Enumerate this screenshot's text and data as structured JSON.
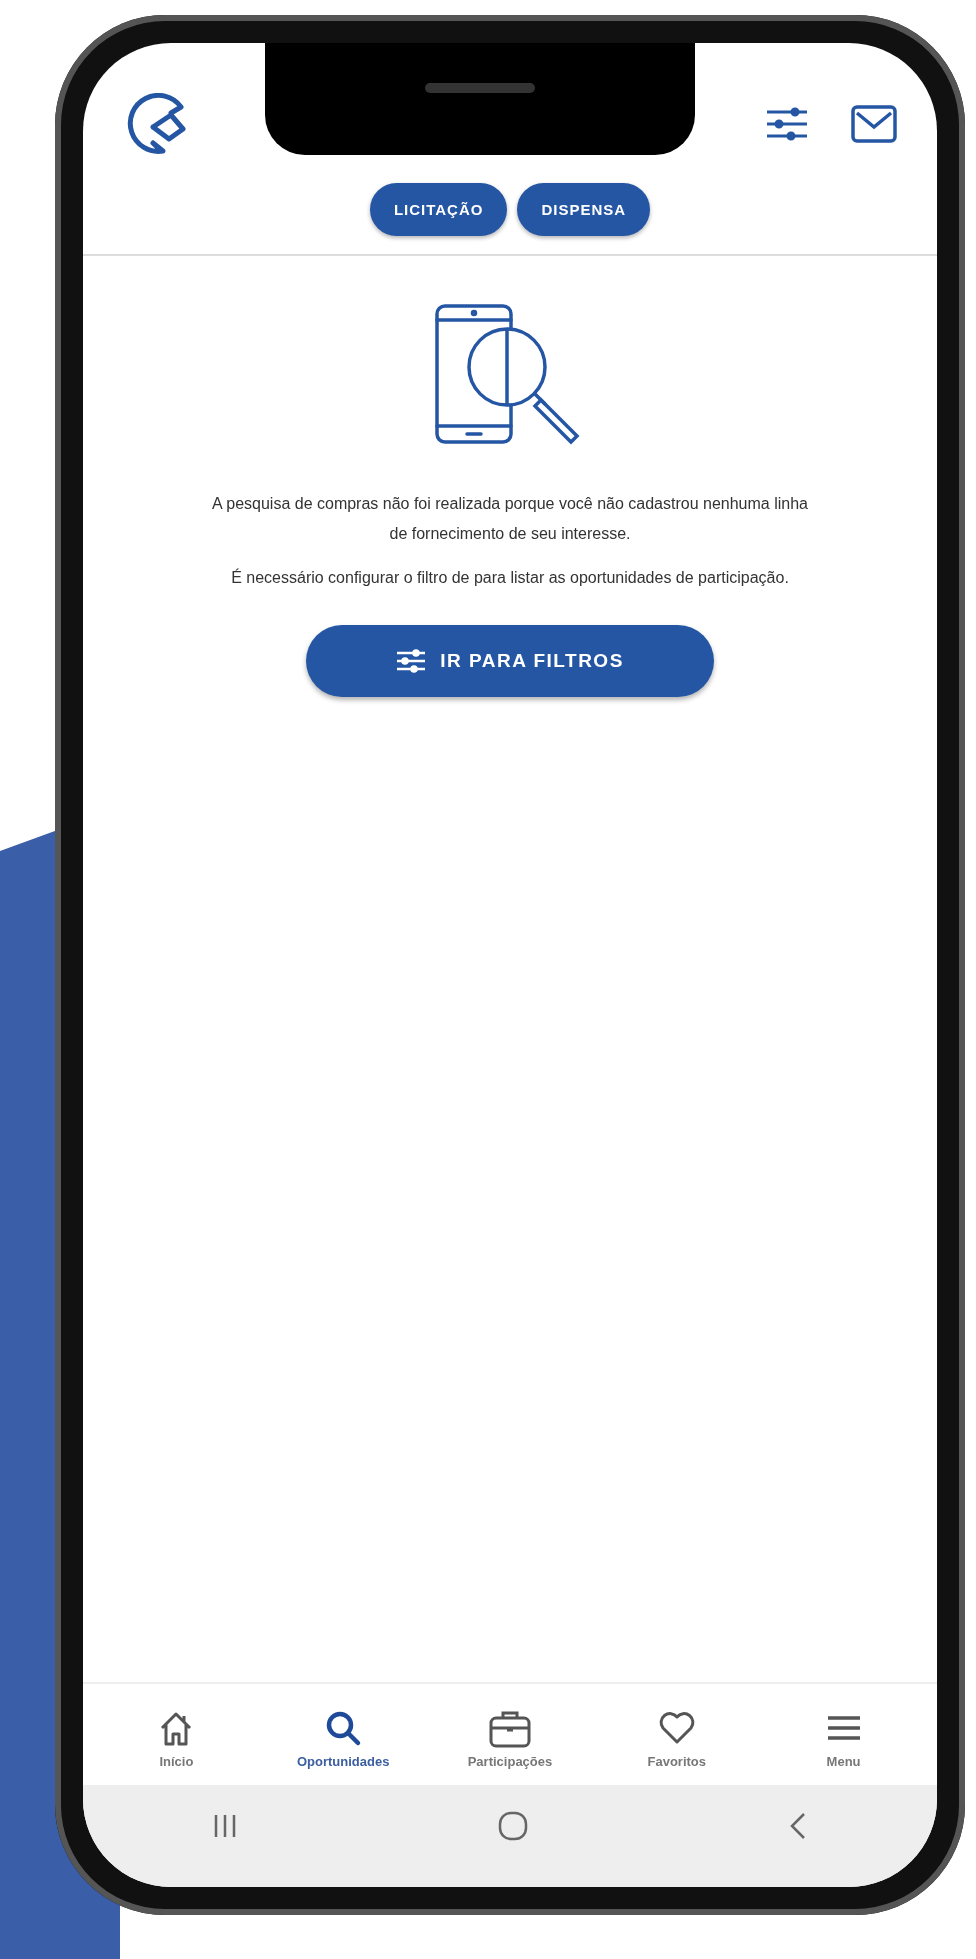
{
  "header": {
    "tabs": [
      {
        "label": "LICITAÇÃO"
      },
      {
        "label": "DISPENSA"
      }
    ]
  },
  "empty_state": {
    "messages": [
      "A pesquisa de compras não foi realizada porque você não cadastrou nenhuma linha de fornecimento de seu interesse.",
      "É necessário configurar o filtro de para listar as oportunidades de participação."
    ],
    "button": "IR PARA FILTROS"
  },
  "bottom_nav": [
    {
      "label": "Início",
      "selected": false
    },
    {
      "label": "Oportunidades",
      "selected": true
    },
    {
      "label": "Participações",
      "selected": false
    },
    {
      "label": "Favoritos",
      "selected": false
    },
    {
      "label": "Menu",
      "selected": false
    }
  ]
}
